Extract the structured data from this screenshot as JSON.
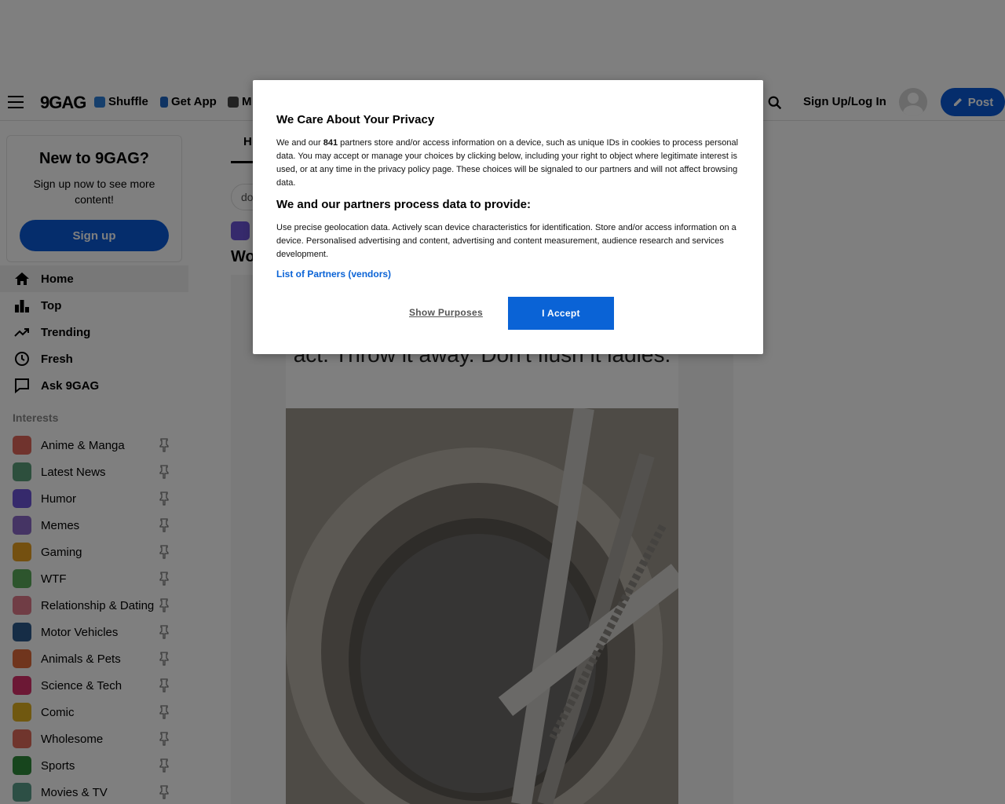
{
  "topbar": {
    "logo": "9GAG",
    "links": [
      {
        "label": "Shuffle",
        "icon": "shuffle-icon"
      },
      {
        "label": "Get App",
        "icon": "phone-icon"
      },
      {
        "label": "M",
        "icon": "meme-icon"
      }
    ],
    "login_label": "Sign Up/Log In",
    "post_label": "Post"
  },
  "sidebar": {
    "signup_card": {
      "title": "New to 9GAG?",
      "text": "Sign up now to see more content!",
      "button": "Sign up"
    },
    "nav": [
      {
        "label": "Home",
        "icon": "home-icon"
      },
      {
        "label": "Top",
        "icon": "bar-chart-icon"
      },
      {
        "label": "Trending",
        "icon": "trending-icon"
      },
      {
        "label": "Fresh",
        "icon": "clock-icon"
      },
      {
        "label": "Ask 9GAG",
        "icon": "chat-icon"
      }
    ],
    "interests_label": "Interests",
    "interests": [
      {
        "label": "Anime & Manga",
        "color": "#e0665a"
      },
      {
        "label": "Latest News",
        "color": "#5a9e7a"
      },
      {
        "label": "Humor",
        "color": "#6d55d8"
      },
      {
        "label": "Memes",
        "color": "#8a68c9"
      },
      {
        "label": "Gaming",
        "color": "#e8a020"
      },
      {
        "label": "WTF",
        "color": "#5aaa5a"
      },
      {
        "label": "Relationship & Dating",
        "color": "#e07a8a"
      },
      {
        "label": "Motor Vehicles",
        "color": "#2d5a8c"
      },
      {
        "label": "Animals & Pets",
        "color": "#e06a3a"
      },
      {
        "label": "Science & Tech",
        "color": "#d8306a"
      },
      {
        "label": "Comic",
        "color": "#e0b020"
      },
      {
        "label": "Wholesome",
        "color": "#e06a5a"
      },
      {
        "label": "Sports",
        "color": "#2e8a3a"
      },
      {
        "label": "Movies & TV",
        "color": "#5a9e8a"
      }
    ]
  },
  "main": {
    "tab": "H",
    "tag_chip": "do",
    "post_title": "Wo",
    "caption": "act. Throw it away. Don't flush it ladies."
  },
  "consent": {
    "title": "We Care About Your Privacy",
    "intro_before": "We and our ",
    "partner_count": "841",
    "intro_after": " partners store and/or access information on a device, such as unique IDs in cookies to process personal data. You may accept or manage your choices by clicking below, including your right to object where legitimate interest is used, or at any time in the privacy policy page. These choices will be signaled to our partners and will not affect browsing data.",
    "subtitle": "We and our partners process data to provide:",
    "purposes": "Use precise geolocation data. Actively scan device characteristics for identification. Store and/or access information on a device. Personalised advertising and content, advertising and content measurement, audience research and services development.",
    "vendors_link": "List of Partners (vendors)",
    "show_purposes": "Show Purposes",
    "accept": "I Accept"
  }
}
